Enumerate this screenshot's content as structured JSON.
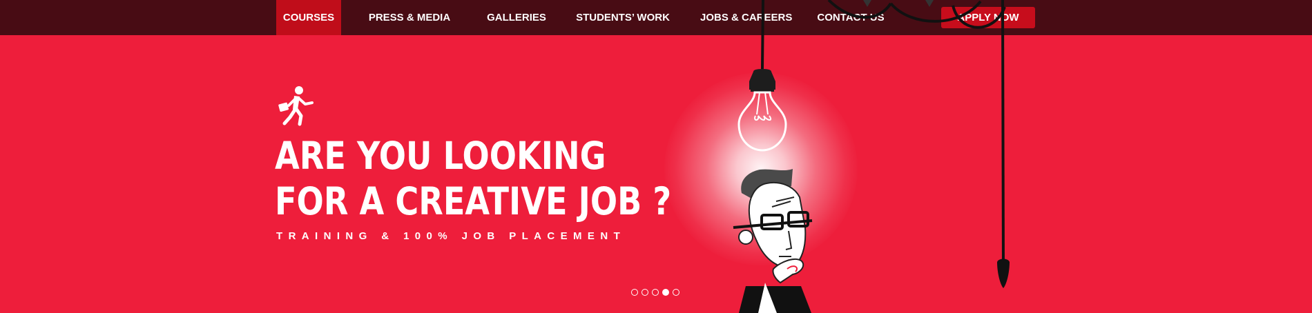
{
  "nav": {
    "items": [
      {
        "label": "COURSES",
        "active": true
      },
      {
        "label": "PRESS & MEDIA",
        "active": false
      },
      {
        "label": "GALLERIES",
        "active": false
      },
      {
        "label": "STUDENTS’ WORK",
        "active": false
      },
      {
        "label": "JOBS & CAREERS",
        "active": false
      },
      {
        "label": "CONTACT US",
        "active": false
      }
    ],
    "apply_label": "APPLY NOW"
  },
  "hero": {
    "headline_line1": "ARE YOU LOOKING",
    "headline_line2": "FOR A CREATIVE JOB ?",
    "subline": "TRAINING & 100% JOB PLACEMENT",
    "icon": "running-businessman-icon",
    "illustration": "thinking-man-under-lightbulb"
  },
  "slider": {
    "total_slides": 5,
    "active_slide": 4
  },
  "colors": {
    "hero_bg": "#ee1e3b",
    "nav_bg": "#480c14",
    "accent": "#c00d1a",
    "text": "#ffffff"
  }
}
